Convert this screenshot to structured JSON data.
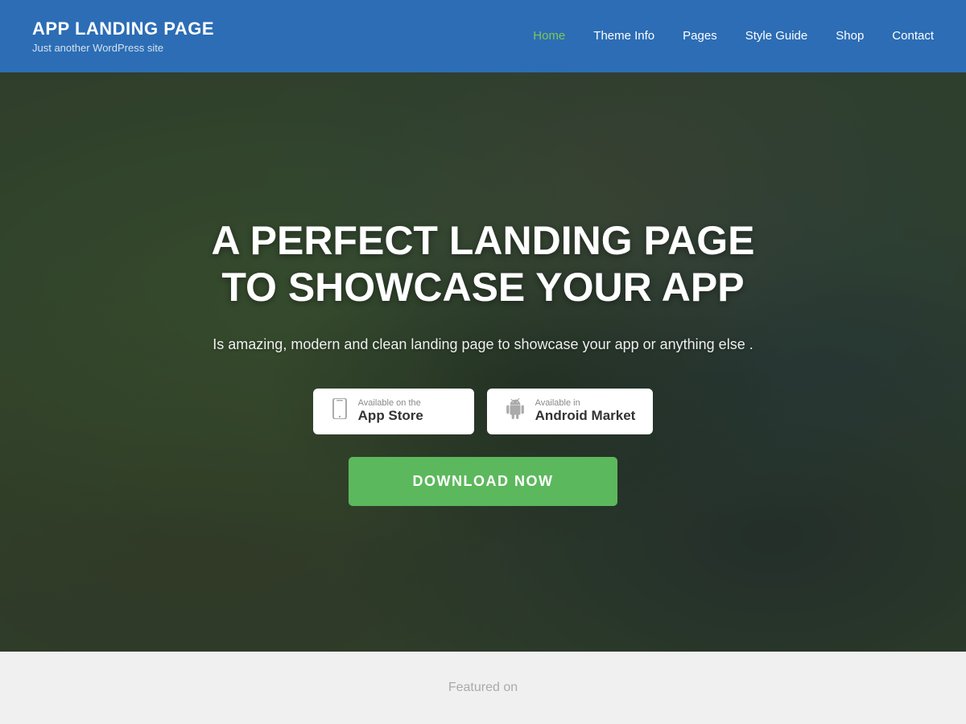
{
  "header": {
    "site_title": "APP LANDING PAGE",
    "site_tagline": "Just another WordPress site",
    "nav": {
      "items": [
        {
          "label": "Home",
          "active": true
        },
        {
          "label": "Theme Info",
          "active": false
        },
        {
          "label": "Pages",
          "active": false
        },
        {
          "label": "Style Guide",
          "active": false
        },
        {
          "label": "Shop",
          "active": false
        },
        {
          "label": "Contact",
          "active": false
        }
      ]
    }
  },
  "hero": {
    "headline": "A PERFECT LANDING PAGE TO SHOWCASE YOUR APP",
    "subheadline": "Is amazing, modern and clean landing page to showcase your app or anything else .",
    "app_store_button": {
      "small_text": "Available on the",
      "large_text": "App Store"
    },
    "android_button": {
      "small_text": "Available in",
      "large_text": "Android Market"
    },
    "download_button": "DOWNLOAD NOW"
  },
  "featured": {
    "label": "Featured on"
  },
  "colors": {
    "header_bg": "#2c6db5",
    "active_nav": "#7dc855",
    "download_btn": "#5cb85c"
  }
}
